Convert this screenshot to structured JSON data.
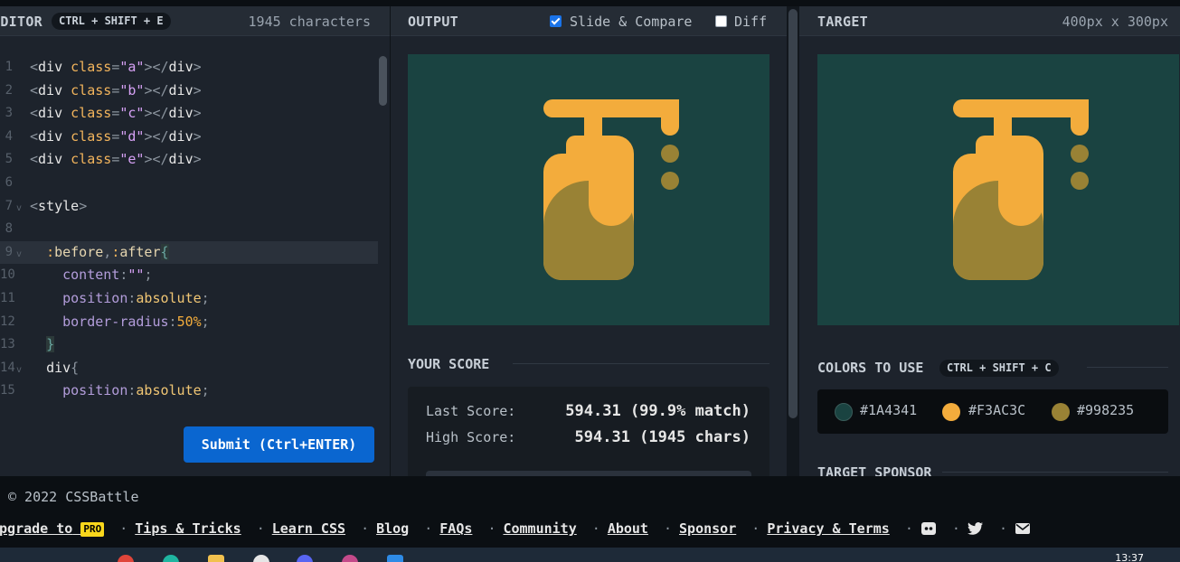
{
  "editor": {
    "title": "EDITOR",
    "shortcut": "CTRL + SHIFT + E",
    "char_count": "1945 characters",
    "submit_label": "Submit (Ctrl+ENTER)"
  },
  "output": {
    "title": "OUTPUT",
    "slide_compare_label": "Slide & Compare",
    "slide_compare_checked": true,
    "diff_label": "Diff",
    "diff_checked": false
  },
  "score": {
    "title": "YOUR SCORE",
    "last_label": "Last Score:",
    "last_value": "594.31 (99.9% match)",
    "high_label": "High Score:",
    "high_value": "594.31 (1945 chars)"
  },
  "target": {
    "title": "TARGET",
    "size": "400px x 300px",
    "colors_title": "COLORS TO USE",
    "colors_shortcut": "CTRL + SHIFT + C",
    "colors": [
      "#1A4341",
      "#F3AC3C",
      "#998235"
    ],
    "sponsor_title": "TARGET SPONSOR"
  },
  "footer": {
    "copyright": "© 2022 CSSBattle",
    "upgrade": "Upgrade to",
    "pro": "PRO",
    "links": [
      "Tips & Tricks",
      "Learn CSS",
      "Blog",
      "FAQs",
      "Community",
      "About",
      "Sponsor",
      "Privacy & Terms"
    ],
    "icons": [
      "discord-icon",
      "twitter-icon",
      "mail-icon"
    ]
  },
  "taskbar": {
    "time": "13:37"
  }
}
